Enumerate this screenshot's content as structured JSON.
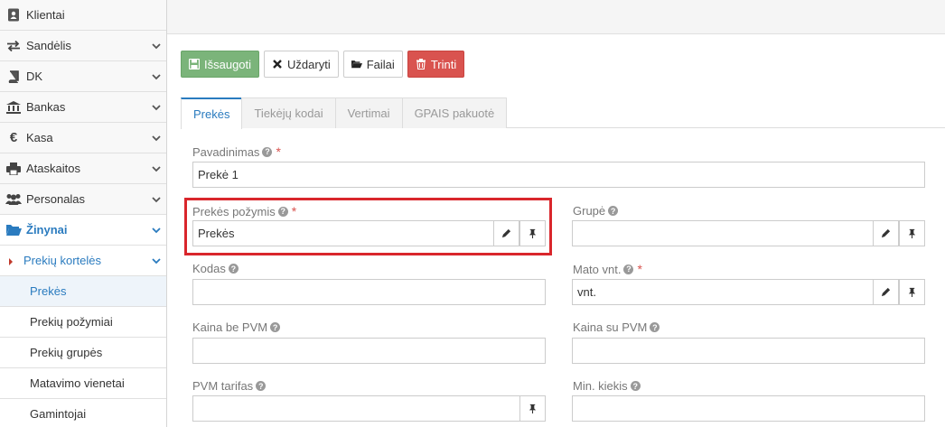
{
  "sidebar": {
    "items": [
      {
        "label": "Klientai",
        "icon": "address-book-icon"
      },
      {
        "label": "Sandėlis",
        "icon": "exchange-icon"
      },
      {
        "label": "DK",
        "icon": "book-icon"
      },
      {
        "label": "Bankas",
        "icon": "bank-icon"
      },
      {
        "label": "Kasa",
        "icon": "euro-icon"
      },
      {
        "label": "Ataskaitos",
        "icon": "print-icon"
      },
      {
        "label": "Personalas",
        "icon": "users-icon"
      },
      {
        "label": "Žinynai",
        "icon": "folder-open-icon"
      }
    ],
    "sub": {
      "label": "Prekių kortelės"
    },
    "sub_items": [
      "Prekės",
      "Prekių požymiai",
      "Prekių grupės",
      "Matavimo vienetai",
      "Gamintojai"
    ]
  },
  "toolbar": {
    "save": "Išsaugoti",
    "close": "Uždaryti",
    "files": "Failai",
    "delete": "Trinti"
  },
  "tabs": [
    "Prekės",
    "Tiekėjų kodai",
    "Vertimai",
    "GPAIS pakuotė"
  ],
  "form": {
    "pavadinimas": {
      "label": "Pavadinimas",
      "value": "Prekė 1"
    },
    "pozymis": {
      "label": "Prekės požymis",
      "value": "Prekės"
    },
    "grupe": {
      "label": "Grupė",
      "value": ""
    },
    "kodas": {
      "label": "Kodas",
      "value": ""
    },
    "mato": {
      "label": "Mato vnt.",
      "value": "vnt."
    },
    "kaina_be": {
      "label": "Kaina be PVM",
      "value": ""
    },
    "kaina_su": {
      "label": "Kaina su PVM",
      "value": ""
    },
    "pvm": {
      "label": "PVM tarifas",
      "value": ""
    },
    "min": {
      "label": "Min. kiekis",
      "value": ""
    }
  },
  "colors": {
    "accent": "#2a7bbf",
    "save_green": "#7bb47a",
    "delete_red": "#d9534f",
    "highlight_red": "#d9262c"
  }
}
